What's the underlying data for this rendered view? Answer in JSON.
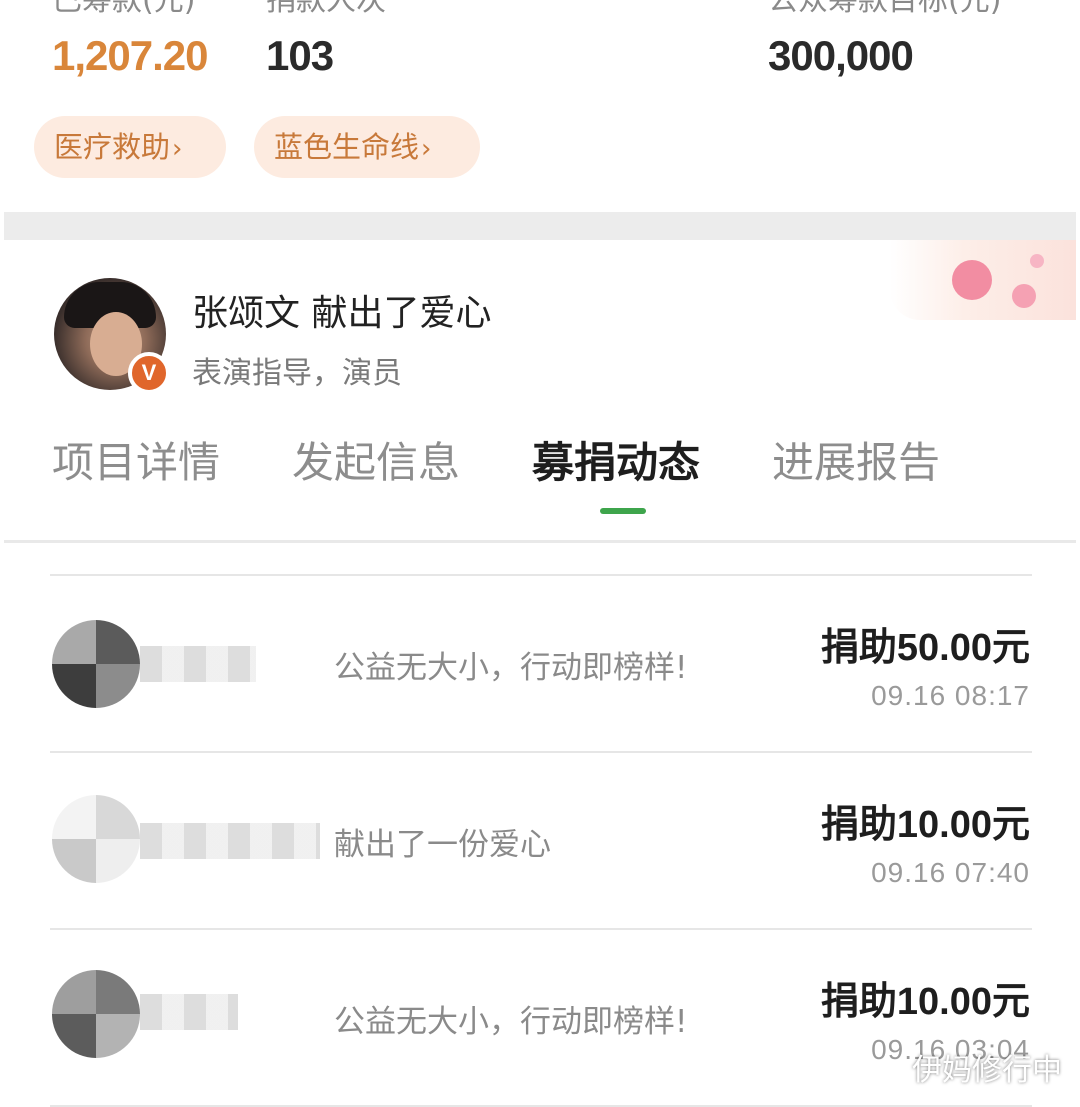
{
  "stats": {
    "raised": {
      "label": "已筹款(元)",
      "value": "1,207.20"
    },
    "donors": {
      "label": "捐款人次",
      "value": "103"
    },
    "target": {
      "label": "公众筹款目标(元)",
      "value": "300,000"
    }
  },
  "tags": [
    {
      "label": "医疗救助",
      "chevron": "›"
    },
    {
      "label": "蓝色生命线",
      "chevron": "›"
    }
  ],
  "celebrity": {
    "title": "张颂文 献出了爱心",
    "subtitle": "表演指导，演员",
    "badge": "V"
  },
  "tabs": [
    {
      "label": "项目详情"
    },
    {
      "label": "发起信息"
    },
    {
      "label": "募捐动态"
    },
    {
      "label": "进展报告"
    }
  ],
  "donations": [
    {
      "message": "公益无大小，行动即榜样!",
      "amount_prefix": "捐助",
      "amount": "50.00",
      "amount_suffix": "元",
      "time": "09.16 08:17"
    },
    {
      "message": "献出了一份爱心",
      "amount_prefix": "捐助",
      "amount": "10.00",
      "amount_suffix": "元",
      "time": "09.16 07:40"
    },
    {
      "message": "公益无大小，行动即榜样!",
      "amount_prefix": "捐助",
      "amount": "10.00",
      "amount_suffix": "元",
      "time": "09.16 03:04"
    }
  ],
  "watermark": "伊妈修行中",
  "colors": {
    "accent_orange": "#d9863a",
    "tab_active_underline": "#3ea54c",
    "tag_bg": "#fdebe0",
    "verified_badge": "#e0662b"
  }
}
